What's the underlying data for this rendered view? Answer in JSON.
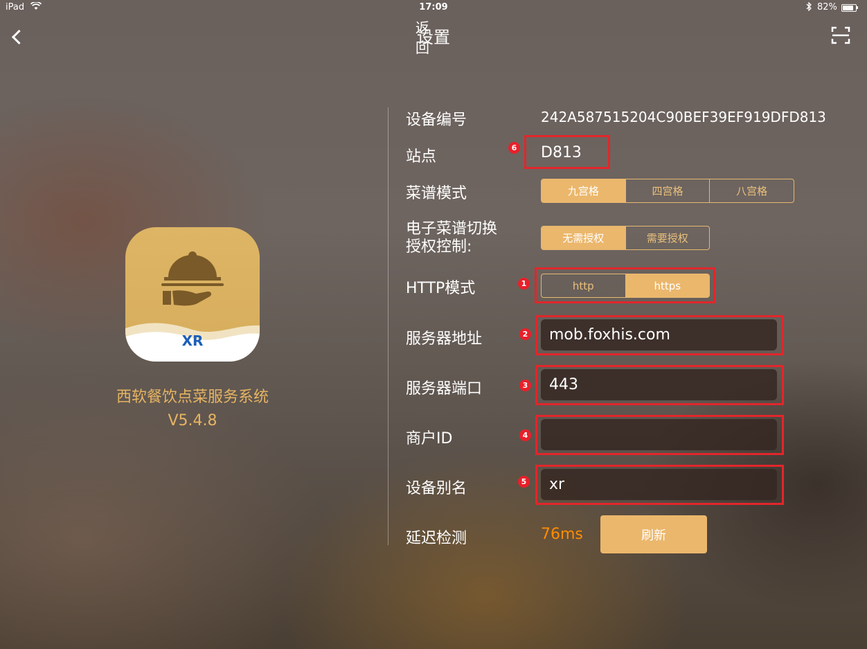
{
  "status_bar": {
    "carrier": "iPad",
    "time": "17:09",
    "battery": "82%"
  },
  "nav": {
    "back_label": "返回",
    "title": "设置"
  },
  "brand": {
    "logo_text": "XR",
    "app_name": "西软餐饮点菜服务系统",
    "version": "V5.4.8"
  },
  "form": {
    "device_id": {
      "label": "设备编号",
      "value": "242A587515204C90BEF39EF919DFD813"
    },
    "site": {
      "label": "站点",
      "value": "D813",
      "badge": "6"
    },
    "menu_mode": {
      "label": "菜谱模式",
      "options": [
        "九宫格",
        "四宫格",
        "八宫格"
      ],
      "selected": "九宫格"
    },
    "auth": {
      "label_line1": "电子菜谱切换",
      "label_line2": "授权控制:",
      "options": [
        "无需授权",
        "需要授权"
      ],
      "selected": "无需授权"
    },
    "http_mode": {
      "label": "HTTP模式",
      "options": [
        "http",
        "https"
      ],
      "selected": "https",
      "badge": "1"
    },
    "server_address": {
      "label": "服务器地址",
      "value": "mob.foxhis.com",
      "badge": "2"
    },
    "server_port": {
      "label": "服务器端口",
      "value": "443",
      "badge": "3"
    },
    "merchant_id": {
      "label": "商户ID",
      "value": "",
      "badge": "4"
    },
    "device_alias": {
      "label": "设备别名",
      "value": "xr",
      "badge": "5"
    },
    "latency": {
      "label": "延迟检测",
      "value": "76ms",
      "refresh_label": "刷新"
    }
  },
  "colors": {
    "accent": "#ebb76c",
    "highlight_box": "#e2262b",
    "latency": "#ff8c00",
    "brand_text": "#e6b462"
  }
}
